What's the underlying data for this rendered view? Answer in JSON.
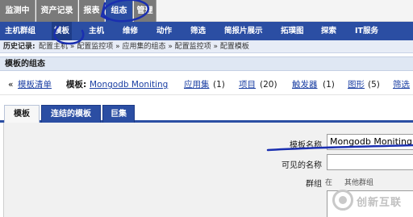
{
  "top_tabs": [
    "监测中",
    "资产记录",
    "报表",
    "组态",
    "管理"
  ],
  "menu": [
    "主机群组",
    "模板",
    "主机",
    "维修",
    "动作",
    "筛选",
    "简报片展示",
    "拓璞图",
    "探索",
    "IT服务"
  ],
  "history": {
    "label": "历史记录:",
    "path": "配置主机 » 配置监控项 » 应用集的组态 » 配置监控项 » 配置模板"
  },
  "section_title": "模板的组态",
  "summary": {
    "back_arrow": "«",
    "template_list": "模板清单",
    "template_label": "模板:",
    "template_name": "Mongodb Moniting",
    "applications": "应用集",
    "applications_count": "(1)",
    "items": "项目",
    "items_count": "(20)",
    "triggers": "触发器",
    "triggers_count": "(1)",
    "graphs": "图形",
    "graphs_count": "(5)",
    "filter": "筛选"
  },
  "form_tabs": [
    "模板",
    "连结的模板",
    "巨集"
  ],
  "form": {
    "template_name_label": "模板名称",
    "template_name_value": "Mongodb Moniting",
    "visible_name_label": "可见的名称",
    "visible_name_value": "",
    "groups_label": "群组",
    "groups_hint": "在",
    "groups_other": "其他群组"
  },
  "watermark": "创新互联",
  "colors": {
    "tab_gray": "#7a7a7a",
    "menu_blue": "#2b4ea3",
    "annotation_blue": "#1a2fb0",
    "link_blue": "#1b3fa3"
  }
}
